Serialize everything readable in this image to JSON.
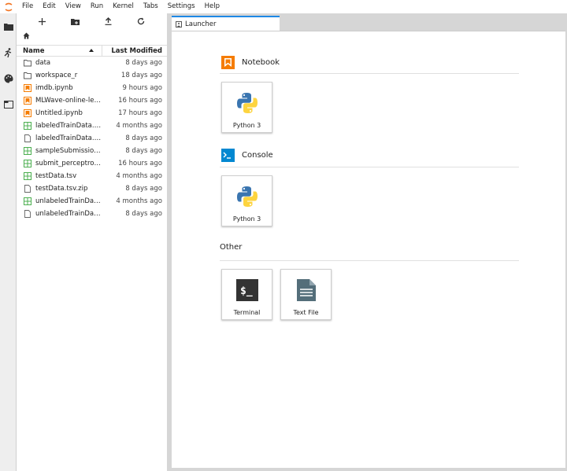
{
  "menu": {
    "items": [
      "File",
      "Edit",
      "View",
      "Run",
      "Kernel",
      "Tabs",
      "Settings",
      "Help"
    ]
  },
  "left_strip": {
    "icons": [
      "folder-icon",
      "running-icon",
      "palette-icon",
      "tabs-icon"
    ]
  },
  "file_browser": {
    "toolbar": [
      "new-launcher-icon",
      "new-folder-icon",
      "upload-icon",
      "refresh-icon"
    ],
    "columns": {
      "name": "Name",
      "modified": "Last Modified"
    },
    "files": [
      {
        "name": "data",
        "modified": "8 days ago",
        "kind": "folder"
      },
      {
        "name": "workspace_r",
        "modified": "18 days ago",
        "kind": "folder"
      },
      {
        "name": "imdb.ipynb",
        "modified": "9 hours ago",
        "kind": "notebook"
      },
      {
        "name": "MLWave-online-lear...",
        "modified": "16 hours ago",
        "kind": "notebook"
      },
      {
        "name": "Untitled.ipynb",
        "modified": "17 hours ago",
        "kind": "notebook"
      },
      {
        "name": "labeledTrainData.tsv",
        "modified": "4 months ago",
        "kind": "table"
      },
      {
        "name": "labeledTrainData.tsv...",
        "modified": "8 days ago",
        "kind": "file"
      },
      {
        "name": "sampleSubmission.csv",
        "modified": "8 days ago",
        "kind": "table"
      },
      {
        "name": "submit_perceptron.c...",
        "modified": "16 hours ago",
        "kind": "table"
      },
      {
        "name": "testData.tsv",
        "modified": "4 months ago",
        "kind": "table"
      },
      {
        "name": "testData.tsv.zip",
        "modified": "8 days ago",
        "kind": "file"
      },
      {
        "name": "unlabeledTrainData...",
        "modified": "4 months ago",
        "kind": "table"
      },
      {
        "name": "unlabeledTrainData...",
        "modified": "8 days ago",
        "kind": "file"
      }
    ]
  },
  "tab": {
    "label": "Launcher"
  },
  "launcher": {
    "notebook": {
      "title": "Notebook",
      "card_label": "Python 3"
    },
    "console": {
      "title": "Console",
      "card_label": "Python 3"
    },
    "other": {
      "title": "Other",
      "terminal_label": "Terminal",
      "textfile_label": "Text File"
    }
  },
  "colors": {
    "accent_blue": "#1e88e5",
    "notebook_orange": "#f57c00",
    "console_blue": "#0288d1",
    "table_green": "#4caf50",
    "terminal_dark": "#333333",
    "textfile_slate": "#546e7a"
  }
}
